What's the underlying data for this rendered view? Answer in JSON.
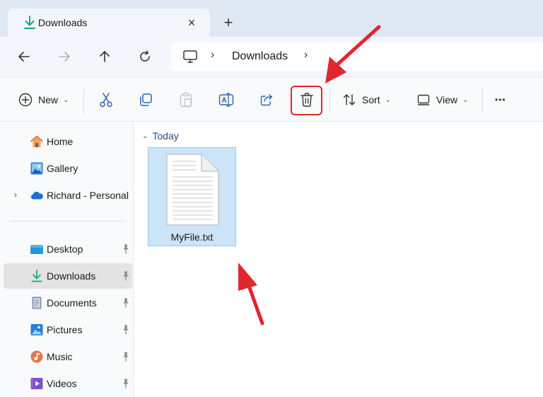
{
  "tab": {
    "title": "Downloads",
    "close_glyph": "×",
    "new_glyph": "+"
  },
  "navigation": {
    "back_icon": "arrow-left-icon",
    "forward_icon": "arrow-right-icon",
    "up_icon": "arrow-up-icon",
    "refresh_icon": "refresh-icon"
  },
  "address": {
    "separator": "›",
    "location": "Downloads"
  },
  "toolbar": {
    "new_label": "New",
    "sort_label": "Sort",
    "view_label": "View",
    "caret": "⌄",
    "more_glyph": "•••"
  },
  "sidebar": {
    "items": [
      {
        "label": "Home",
        "icon": "home-icon"
      },
      {
        "label": "Gallery",
        "icon": "gallery-icon"
      },
      {
        "label": "Richard - Personal",
        "icon": "onedrive-cloud-icon",
        "expand": "›"
      },
      {
        "label": "Desktop",
        "icon": "desktop-folder-icon",
        "pinned": true
      },
      {
        "label": "Downloads",
        "icon": "downloads-icon",
        "pinned": true,
        "selected": true
      },
      {
        "label": "Documents",
        "icon": "documents-icon",
        "pinned": true
      },
      {
        "label": "Pictures",
        "icon": "pictures-icon",
        "pinned": true
      },
      {
        "label": "Music",
        "icon": "music-icon",
        "pinned": true
      },
      {
        "label": "Videos",
        "icon": "videos-icon",
        "pinned": true
      }
    ]
  },
  "content": {
    "group_label": "Today",
    "group_chevron": "⌄",
    "files": [
      {
        "name": "MyFile.txt",
        "icon": "text-file-icon",
        "selected": true
      }
    ]
  },
  "colors": {
    "accent_green": "#1aa67a",
    "annotation_red": "#e0272d",
    "selection_fill": "#cce4f7",
    "group_header": "#2a4a8a"
  }
}
